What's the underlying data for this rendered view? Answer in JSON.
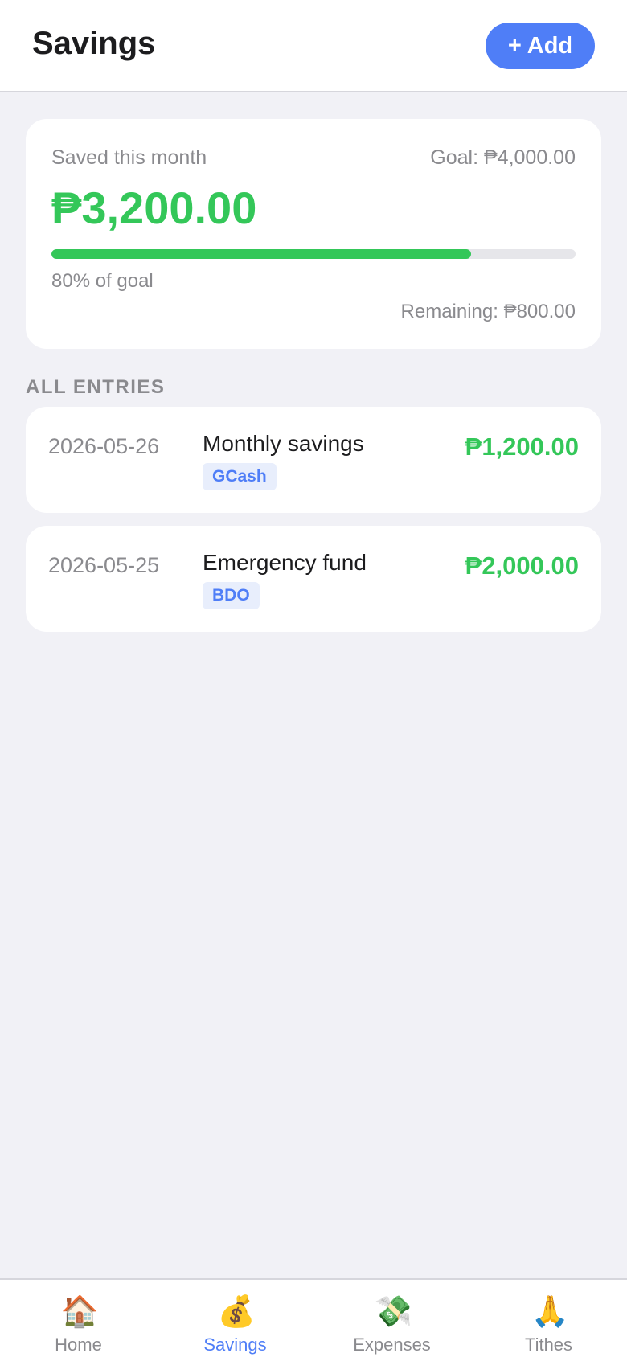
{
  "header": {
    "title": "Savings",
    "add_label": "+ Add"
  },
  "summary": {
    "saved_label": "Saved this month",
    "goal_text": "Goal: ₱4,000.00",
    "saved_amount": "₱3,200.00",
    "progress_fraction": 0.8,
    "percent_text": "80% of goal",
    "remaining_text": "Remaining: ₱800.00"
  },
  "entries_section": {
    "label": "ALL ENTRIES",
    "entries": [
      {
        "date": "2026-05-26",
        "title": "Monthly savings",
        "tag": "GCash",
        "amount": "₱1,200.00"
      },
      {
        "date": "2026-05-25",
        "title": "Emergency fund",
        "tag": "BDO",
        "amount": "₱2,000.00"
      }
    ]
  },
  "nav": {
    "items": [
      {
        "label": "Home",
        "icon": "🏠",
        "icon_name": "house-icon",
        "active": false
      },
      {
        "label": "Savings",
        "icon": "💰",
        "icon_name": "money-bag-icon",
        "active": true
      },
      {
        "label": "Expenses",
        "icon": "💸",
        "icon_name": "money-with-wings-icon",
        "active": false
      },
      {
        "label": "Tithes",
        "icon": "🙏",
        "icon_name": "praying-hands-icon",
        "active": false
      }
    ]
  },
  "colors": {
    "accent": "#4f7ef7",
    "positive": "#34c759",
    "background": "#f1f1f6"
  }
}
